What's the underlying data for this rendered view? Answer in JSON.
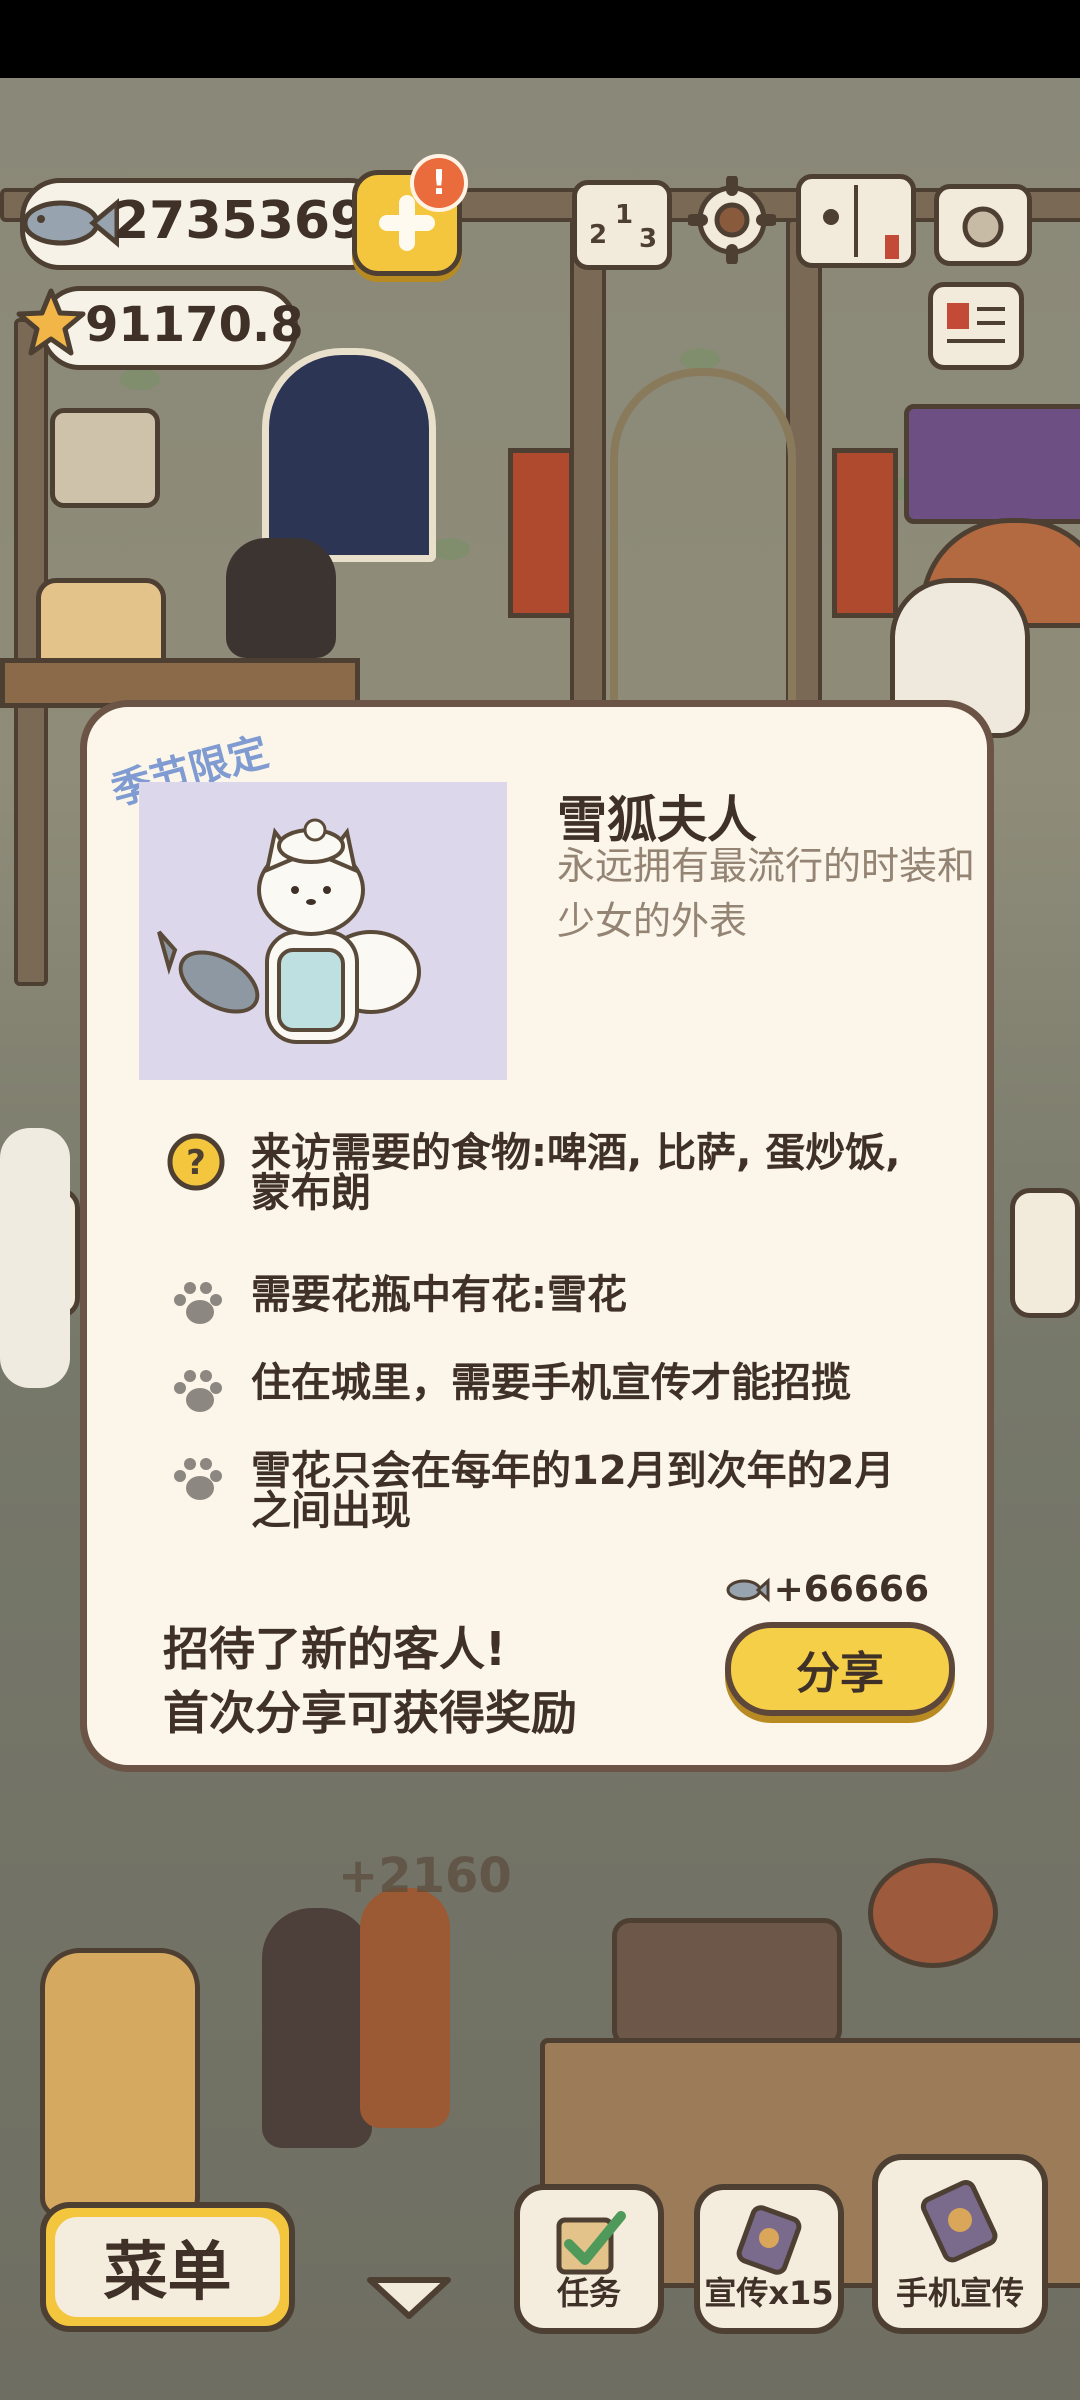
{
  "currency": {
    "fish_count": "2735369",
    "star_count": "91170.8",
    "alert_badge": "!"
  },
  "dialog": {
    "season_tag": "季节限定",
    "guest_name": "雪狐夫人",
    "guest_description": "永远拥有最流行的时装和少女的外表",
    "requirements": [
      {
        "icon": "question-icon",
        "text": "来访需要的食物:啤酒, 比萨, 蛋炒饭, 蒙布朗"
      },
      {
        "icon": "paw-icon",
        "text": "需要花瓶中有花:雪花"
      },
      {
        "icon": "paw-icon",
        "text": "住在城里，需要手机宣传才能招揽"
      },
      {
        "icon": "paw-icon",
        "text": "雪花只会在每年的12月到次年的2月之间出现"
      }
    ],
    "reward": "+66666",
    "invite_line1": "招待了新的客人!",
    "invite_line2": "首次分享可获得奖励",
    "share_label": "分享"
  },
  "background": {
    "floating_number": "+2160"
  },
  "bottom_bar": {
    "menu_label": "菜单",
    "tasks_label": "任务",
    "promo_label": "宣传x15",
    "phone_promo_label": "手机宣传"
  },
  "colors": {
    "accent_yellow": "#f4c63d",
    "panel_bg": "#fbf5ea",
    "outline": "#4e3f33",
    "season_tag": "#7f9bd1",
    "alert": "#ea6b3b"
  }
}
